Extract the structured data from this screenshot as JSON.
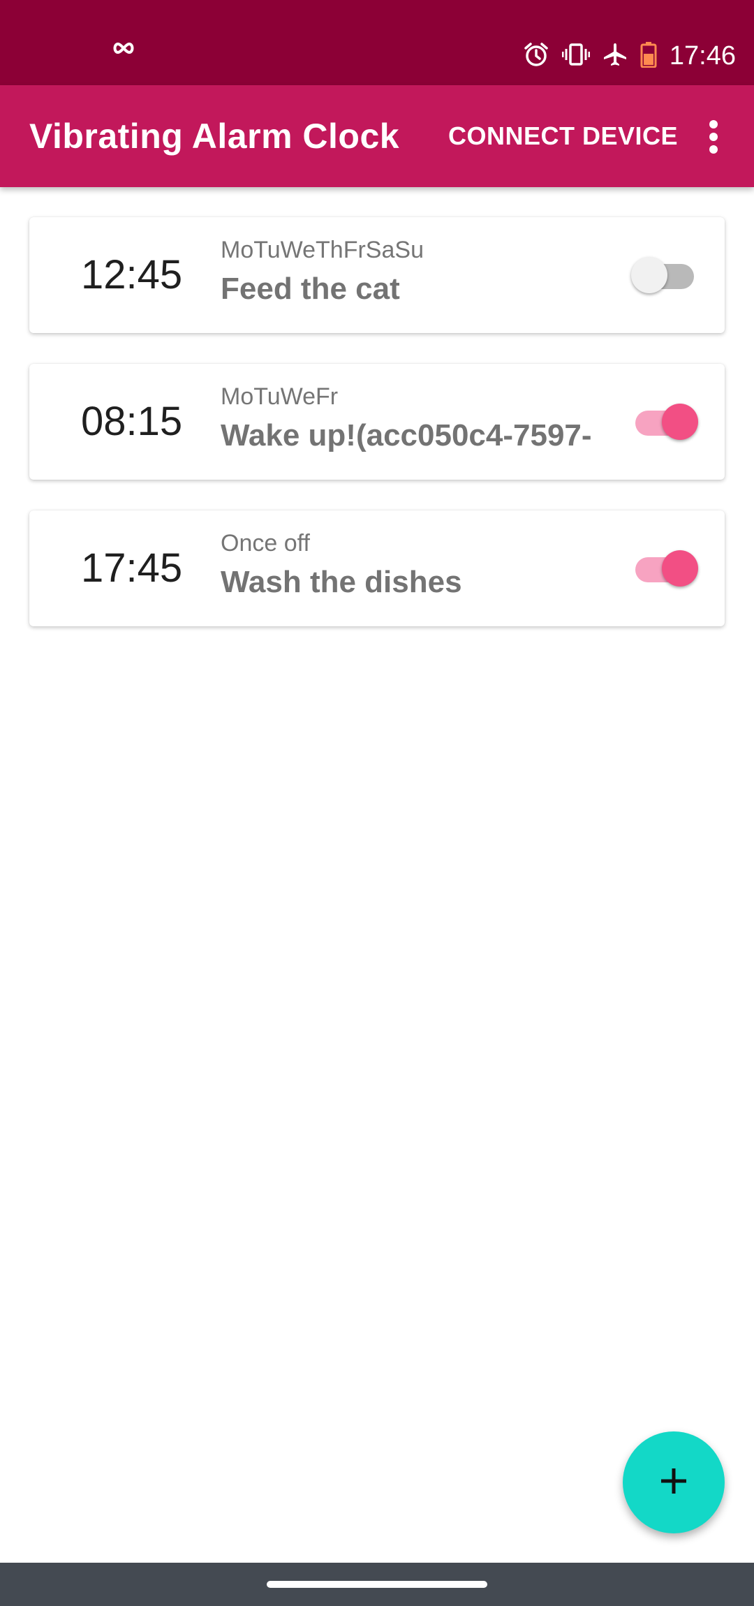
{
  "status_bar": {
    "time": "17:46",
    "icons": [
      "infinity-icon",
      "alarm-icon",
      "vibrate-icon",
      "airplane-mode-icon",
      "battery-saver-icon"
    ]
  },
  "app_bar": {
    "title": "Vibrating Alarm Clock",
    "connect_label": "CONNECT DEVICE",
    "menu_icon": "more-vert-icon"
  },
  "alarms": [
    {
      "time": "12:45",
      "days": "MoTuWeThFrSaSu",
      "label": "Feed the cat",
      "enabled": false
    },
    {
      "time": "08:15",
      "days": "MoTuWeFr",
      "label": "Wake up!(acc050c4-7597-",
      "enabled": true
    },
    {
      "time": "17:45",
      "days": "Once off",
      "label": "Wash the dishes",
      "enabled": true
    }
  ],
  "fab": {
    "icon": "add-icon"
  },
  "colors": {
    "status_bar": "#8c0036",
    "app_bar": "#c2185b",
    "switch_on": "#f24f84",
    "fab": "#13d8c7"
  }
}
